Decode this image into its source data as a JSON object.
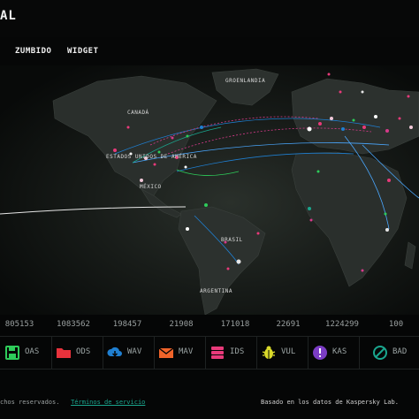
{
  "header": {
    "logo_text": "AL"
  },
  "nav": {
    "items": [
      {
        "label": "ZUMBIDO"
      },
      {
        "label": "WIDGET"
      }
    ]
  },
  "map": {
    "labels": {
      "greenland": "GROENLANDIA",
      "canada": "CANADÁ",
      "usa": "ESTADOS UNIDOS DE AMÉRICA",
      "mexico": "MÉXICO",
      "brazil": "BRASIL",
      "argentina": "ARGENTINA"
    }
  },
  "stats": [
    "805153",
    "1083562",
    "198457",
    "21908",
    "171018",
    "22691",
    "1224299",
    "100"
  ],
  "legend": [
    {
      "label": "OAS",
      "icon": "save-icon",
      "color": "#2ecc5a"
    },
    {
      "label": "ODS",
      "icon": "folder-icon",
      "color": "#e8323c"
    },
    {
      "label": "WAV",
      "icon": "cloud-download-icon",
      "color": "#1f7fd1"
    },
    {
      "label": "MAV",
      "icon": "envelope-icon",
      "color": "#f0642a"
    },
    {
      "label": "IDS",
      "icon": "server-icon",
      "color": "#e83a7a"
    },
    {
      "label": "VUL",
      "icon": "bug-icon",
      "color": "#d9d92a"
    },
    {
      "label": "KAS",
      "icon": "alert-icon",
      "color": "#7b3cc4"
    },
    {
      "label": "BAD",
      "icon": "blocked-icon",
      "color": "#1aa68e"
    }
  ],
  "footer": {
    "rights": "chos reservados.",
    "terms": "Términos de servicio",
    "source": "Basado en los datos de Kaspersky Lab."
  }
}
